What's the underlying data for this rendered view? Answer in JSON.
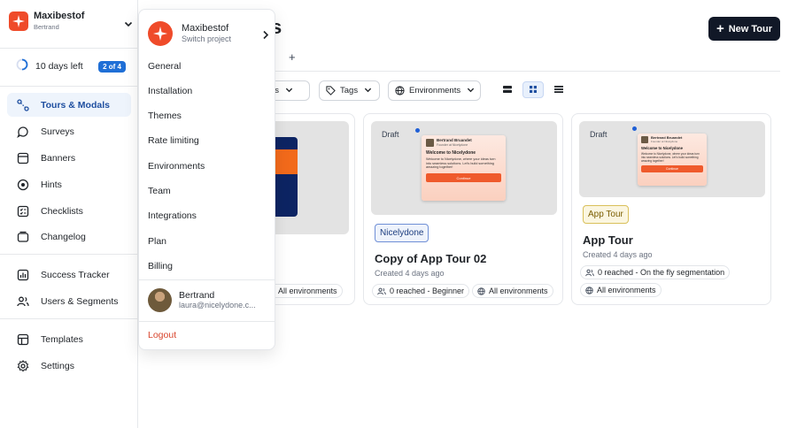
{
  "brand": {
    "name": "Maxibestof",
    "sub": "Bertrand"
  },
  "trial": {
    "text": "10 days left",
    "badge": "2 of 4"
  },
  "nav": [
    {
      "label": "Tours & Modals",
      "icon": "tours-icon",
      "active": true
    },
    {
      "label": "Surveys",
      "icon": "surveys-icon"
    },
    {
      "label": "Banners",
      "icon": "banners-icon"
    },
    {
      "label": "Hints",
      "icon": "hints-icon"
    },
    {
      "label": "Checklists",
      "icon": "checklists-icon"
    },
    {
      "label": "Changelog",
      "icon": "changelog-icon"
    },
    {
      "label": "Success Tracker",
      "icon": "success-tracker-icon"
    },
    {
      "label": "Users & Segments",
      "icon": "users-segments-icon"
    },
    {
      "label": "Templates",
      "icon": "templates-icon"
    },
    {
      "label": "Settings",
      "icon": "settings-icon"
    }
  ],
  "header": {
    "title_fragment": "s",
    "new_button": "New Tour",
    "tab_add": "+"
  },
  "filters": {
    "segments_fragment": "ents",
    "tags": "Tags",
    "environments": "Environments"
  },
  "cards": [
    {
      "chips": [
        "All environments"
      ]
    },
    {
      "draft": "Draft",
      "modal": {
        "name": "Bertrand Bruandet",
        "role": "Founder at Nicelydone",
        "title": "Welcome to Nicelydone",
        "body": "Welcome to Nicelydone, where your ideas turn into seamless solutions. Let's build something amazing together!",
        "cta": "Continue"
      },
      "tag": "Nicelydone",
      "title": "Copy of App Tour 02",
      "created": "Created 4 days ago",
      "chips": [
        "0 reached - Beginner",
        "All environments"
      ]
    },
    {
      "draft": "Draft",
      "modal": {
        "name": "Bertrand Bruandet",
        "role": "Founder at Nicelydone",
        "title": "Welcome to Nicelydone",
        "body": "Welcome to Nicelydone, where your ideas turn into seamless solutions. Let's build something amazing together!",
        "cta": "Continue"
      },
      "tag": "App Tour",
      "title": "App Tour",
      "created": "Created 4 days ago",
      "chips": [
        "0 reached - On the fly segmentation",
        "All environments"
      ]
    }
  ],
  "dropdown": {
    "project": {
      "name": "Maxibestof",
      "sub": "Switch project"
    },
    "items": [
      "General",
      "Installation",
      "Themes",
      "Rate limiting",
      "Environments",
      "Team",
      "Integrations",
      "Plan",
      "Billing"
    ],
    "user": {
      "name": "Bertrand",
      "email": "laura@nicelydone.c..."
    },
    "logout": "Logout"
  },
  "colors": {
    "brand": "#ef4b2a",
    "accent": "#1f6fd6",
    "primary_button": "#111827",
    "logout": "#d9442c"
  }
}
